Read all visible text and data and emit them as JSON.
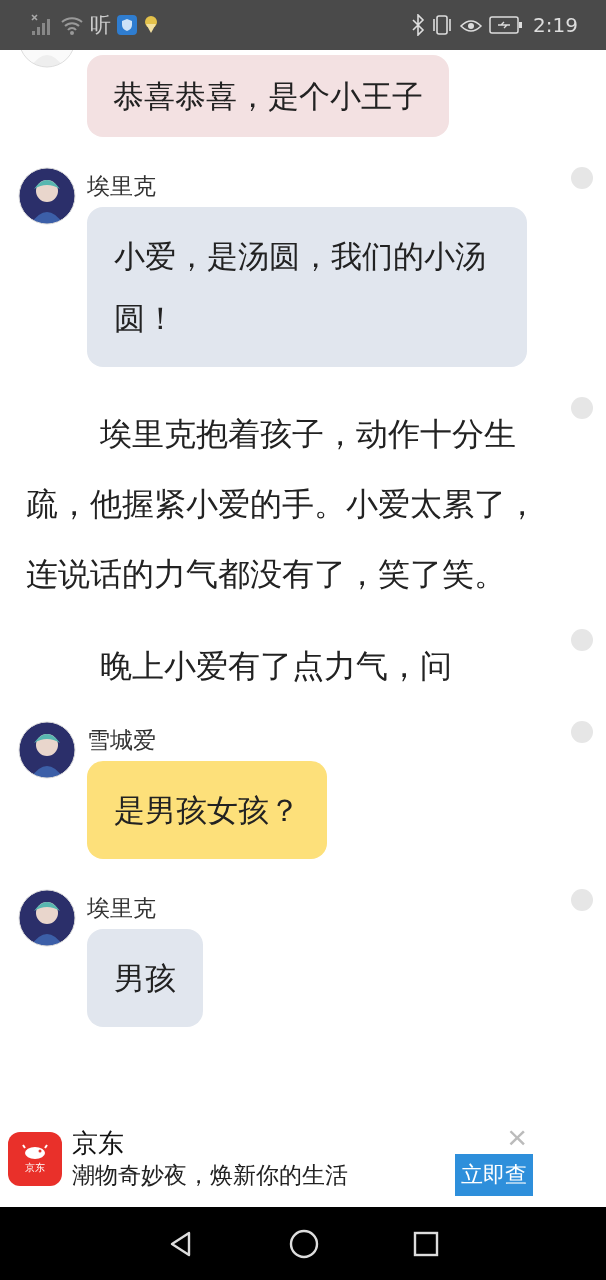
{
  "status_bar": {
    "app_glyph": "听",
    "time": "2:19"
  },
  "items": [
    {
      "kind": "message",
      "text": "恭喜恭喜，是个小王子",
      "color": "#f3e1e2"
    },
    {
      "kind": "message",
      "name": "埃里克",
      "text": "小爱，是汤圆，我们的小汤圆！",
      "color": "#e1e6ee"
    },
    {
      "kind": "narration",
      "text": "埃里克抱着孩子，动作十分生疏，他握紧小爱的手。小爱太累了，连说话的力气都没有了，笑了笑。"
    },
    {
      "kind": "narration",
      "text": "晚上小爱有了点力气，问"
    },
    {
      "kind": "message",
      "name": "雪城爱",
      "text": "是男孩女孩？",
      "color": "#fde07a"
    },
    {
      "kind": "message",
      "name": "埃里克",
      "text": "男孩",
      "color": "#e1e6ee"
    }
  ],
  "ad": {
    "logo_text": "京东",
    "title": "京东",
    "subtitle": "潮物奇妙夜，焕新你的生活",
    "button": "立即查",
    "close": "×"
  }
}
